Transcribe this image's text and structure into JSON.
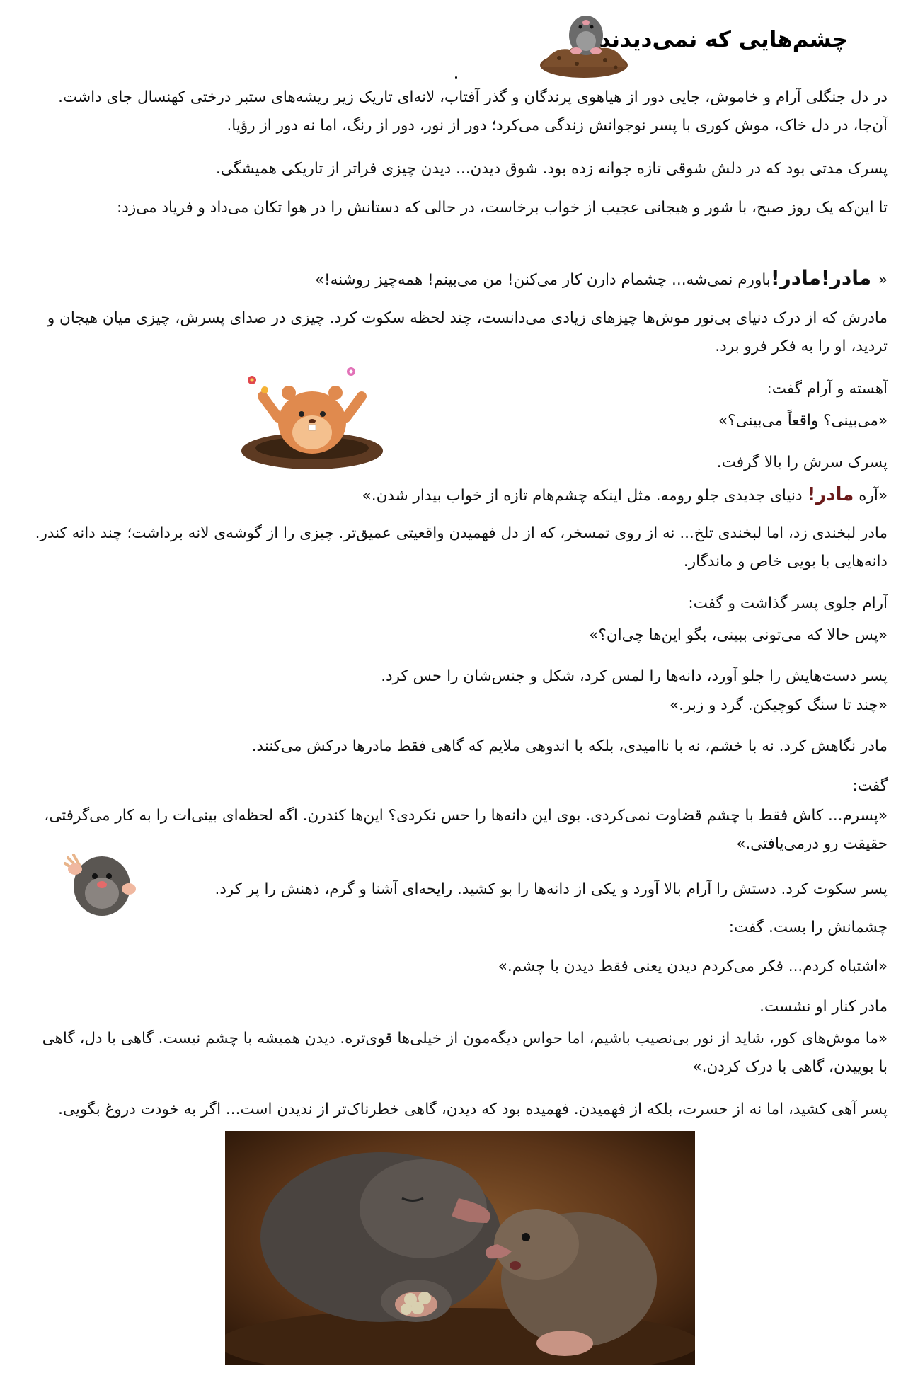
{
  "title": "چشم‌هایی که نمی‌دیدند",
  "paragraphs": {
    "p1": "در دل جنگلی آرام و خاموش، جایی دور از هیاهوی پرندگان و گذر آفتاب، لانه‌ای تاریک زیر ریشه‌های ستبر درختی کهنسال جای داشت. آن‌جا، در دل خاک، موش کوری با پسر نوجوانش زندگی می‌کرد؛ دور از نور، دور از رنگ، اما نه دور از رؤیا.",
    "p2": "پسرک مدتی بود که در دلش شوقی تازه جوانه زده بود. شوق دیدن... دیدن چیزی فراتر از تاریکی همیشگی.",
    "p3": "تا این‌که یک روز صبح، با شور و هیجانی عجیب از خواب برخاست، در حالی که دستانش را در هوا تکان می‌داد و فریاد می‌زد:",
    "p4_prefix": "«",
    "p4_bold": " مادر!مادر!",
    "p4_rest": "باورم نمی‌شه... چشمام دارن کار می‌کنن! من می‌بینم! همه‌چیز روشنه!»",
    "p5": "مادرش که از درک دنیای بی‌نور موش‌ها چیزهای زیادی می‌دانست، چند لحظه سکوت کرد. چیزی در صدای پسرش، چیزی میان هیجان و تردید، او را به فکر فرو برد.",
    "p6": "آهسته و آرام گفت:",
    "p7": "«می‌بینی؟ واقعاً می‌بینی؟»",
    "p8": "پسرک سرش را بالا گرفت.",
    "p9_prefix": "«آره ",
    "p9_maroon": "مادر!",
    "p9_rest": " دنیای جدیدی جلو رومه. مثل اینکه چشم‌هام تازه از خواب بیدار شدن.»",
    "p10": "مادر لبخندی زد، اما لبخندی تلخ... نه از روی تمسخر، که از دل فهمیدن واقعیتی عمیق‌تر. چیزی را از گوشه‌ی لانه برداشت؛ چند دانه کندر. دانه‌هایی با بویی خاص و ماندگار.",
    "p11": "آرام جلوی پسر گذاشت و گفت:",
    "p12": "«پس حالا که می‌تونی ببینی، بگو این‌ها چی‌ان؟»",
    "p13": "پسر دست‌هایش را جلو آورد، دانه‌ها را لمس کرد، شکل و جنس‌شان را حس کرد.",
    "p14": "«چند تا سنگ کوچیکن. گرد و زبر.»",
    "p15": "مادر نگاهش کرد. نه با خشم، نه با ناامیدی، بلکه با اندوهی ملایم که گاهی فقط مادرها درکش می‌کنند.",
    "p16": "گفت:",
    "p17": "«پسرم... کاش فقط با چشم قضاوت نمی‌کردی. بوی این دانه‌ها را حس نکردی؟ این‌ها کندرن. اگه لحظه‌ای بینی‌ات را به کار می‌گرفتی، حقیقت رو درمی‌یافتی.»",
    "p18": "پسر سکوت کرد. دستش را آرام بالا آورد و یکی از دانه‌ها را بو کشید. رایحه‌ای آشنا و گرم، ذهنش را پر کرد.",
    "p19": "چشمانش را بست. گفت:",
    "p20": "«اشتباه کردم... فکر می‌کردم دیدن یعنی فقط دیدن با چشم.»",
    "p21": "مادر کنار او نشست.",
    "p22": "«ما موش‌های کور، شاید از نور بی‌نصیب باشیم، اما حواس دیگه‌مون از خیلی‌ها قوی‌تره. دیدن همیشه با چشم نیست. گاهی با دل، گاهی با بوییدن، گاهی با درک کردن.»",
    "p23": "پسر آهی کشید، اما نه از حسرت، بلکه از فهمیدن. فهمیده بود که دیدن، گاهی خطرناک‌تر از ندیدن است... اگر به خودت دروغ بگویی."
  },
  "colors": {
    "maroon": "#6b1a1a",
    "soil": "#6e4426",
    "hamster": "#e08a4e",
    "mole_dark": "#5a5652",
    "burrow_bg": "#3a2412"
  },
  "icons": {
    "title_illustration": "mole-on-dirt-mound-icon",
    "mid_illustration": "hamster-waving-in-hole-icon",
    "small_illustration": "mole-with-claws-icon",
    "bottom_illustration": "mother-and-son-moles-in-burrow-image"
  }
}
